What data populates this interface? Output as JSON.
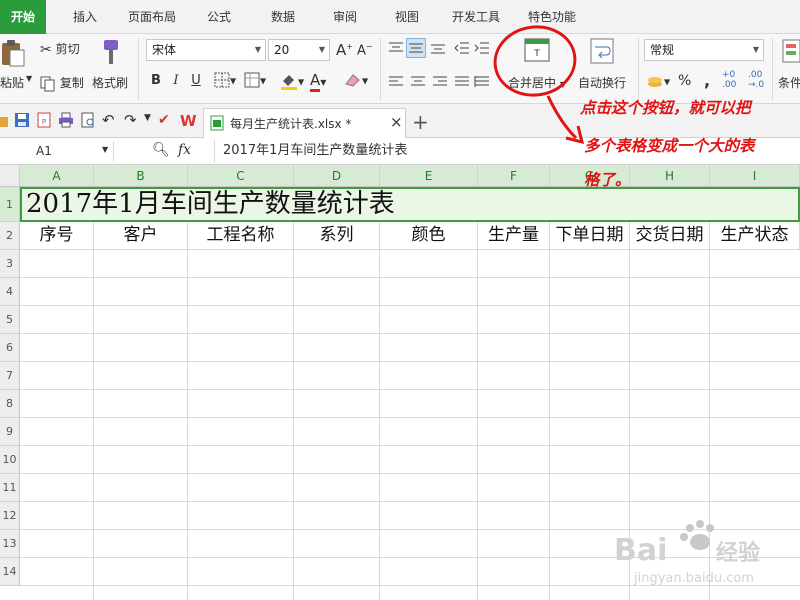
{
  "menu": {
    "tabs": [
      "开始",
      "插入",
      "页面布局",
      "公式",
      "数据",
      "审阅",
      "视图",
      "开发工具",
      "特色功能"
    ],
    "active": "开始"
  },
  "ribbon": {
    "paste": "粘贴",
    "cut": "剪切",
    "copy": "复制",
    "format_painter": "格式刷",
    "font_name": "宋体",
    "font_size": "20",
    "bold": "B",
    "italic": "I",
    "underline": "U",
    "merge_center": "合并居中",
    "wrap_text": "自动换行",
    "number_format": "常规",
    "percent": "%",
    "comma": ",",
    "conditional": "条件"
  },
  "quickbar": {
    "doc_tab": "每月生产统计表.xlsx *",
    "close": "×",
    "add": "+"
  },
  "formula_bar": {
    "name_box": "A1",
    "fx": "fx",
    "content": "2017年1月车间生产数量统计表"
  },
  "sheet": {
    "columns": [
      "A",
      "B",
      "C",
      "D",
      "E",
      "F",
      "G",
      "H",
      "I"
    ],
    "rows": [
      "1",
      "2",
      "3",
      "4",
      "5",
      "6",
      "7",
      "8",
      "9",
      "10",
      "11",
      "12",
      "13",
      "14"
    ],
    "title": "2017年1月车间生产数量统计表",
    "headers": [
      "序号",
      "客户",
      "工程名称",
      "系列",
      "颜色",
      "生产量",
      "下单日期",
      "交货日期",
      "生产状态"
    ]
  },
  "annotation": {
    "line1": "点击这个按钮，就可以把",
    "line2": "多个表格变成一个大的表",
    "line3": "格了。",
    "color": "#e01414"
  },
  "colors": {
    "accent_green": "#2b9c3c",
    "selection_fill": "#eaf6e6",
    "selection_border": "#3f9c3f"
  }
}
